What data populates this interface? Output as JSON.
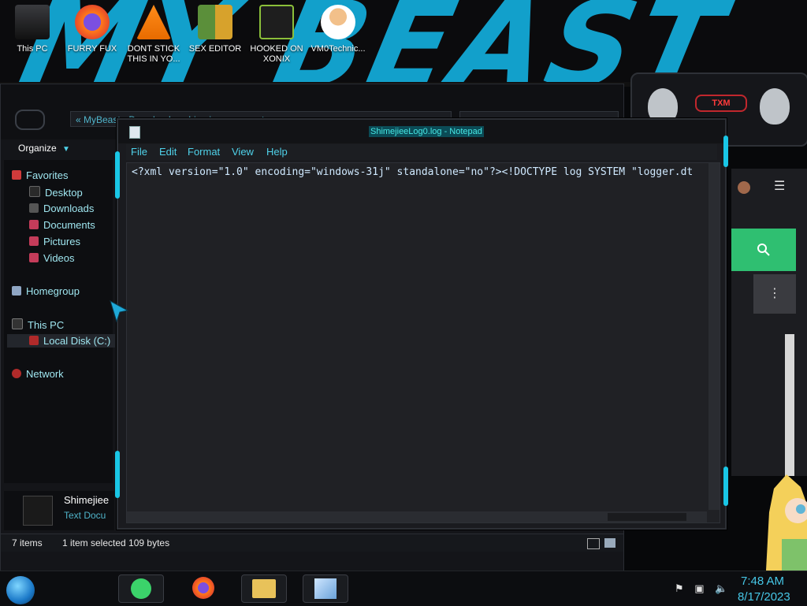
{
  "wallpaper": {
    "brand_text": "MY BEAST"
  },
  "desktop_icons": [
    {
      "label": "This PC",
      "icon": "computer-icon"
    },
    {
      "label": "FURRY FUX",
      "icon": "firefox-icon"
    },
    {
      "label": "DONT STICK THIS IN YO...",
      "icon": "vlc-icon"
    },
    {
      "label": "SEX EDITOR",
      "icon": "editor-icon"
    },
    {
      "label": "HOOKED ON XONIX",
      "icon": "game-icon"
    },
    {
      "label": "VM0Technic...",
      "icon": "doctor-icon"
    }
  ],
  "explorer": {
    "breadcrumb": "« MyBeast › Downloads › shimejee-e-coomatron",
    "organize_label": "Organize",
    "sidebar": {
      "favorites": "Favorites",
      "favorites_items": [
        "Desktop",
        "Downloads",
        "Documents",
        "Pictures",
        "Videos"
      ],
      "homegroup": "Homegroup",
      "this_pc": "This PC",
      "local_disk": "Local Disk (C:)",
      "network": "Network"
    },
    "details": {
      "name": "Shimejiee",
      "type": "Text Docu"
    },
    "status": {
      "items": "7 items",
      "selection": "1 item selected 109 bytes"
    }
  },
  "notepad": {
    "title": "ShimejieeLog0.log - Notepad",
    "menu": [
      "File",
      "Edit",
      "Format",
      "View",
      "Help"
    ],
    "content": "<?xml version=\"1.0\" encoding=\"windows-31j\" standalone=\"no\"?><!DOCTYPE log SYSTEM \"logger.dt"
  },
  "widget": {
    "brand": "TXM"
  },
  "taskbar": {
    "time": "7:48 AM",
    "date": "8/17/2023",
    "apps": [
      "notes-icon",
      "firefox-icon",
      "folder-icon",
      "notepad-icon"
    ],
    "tray_icons": [
      "flag-icon",
      "network-icon",
      "volume-icon"
    ]
  },
  "colors": {
    "accent": "#19c6e6",
    "link": "#4fd2ea",
    "panel": "#1a1b1f",
    "green": "#2fbf71"
  }
}
